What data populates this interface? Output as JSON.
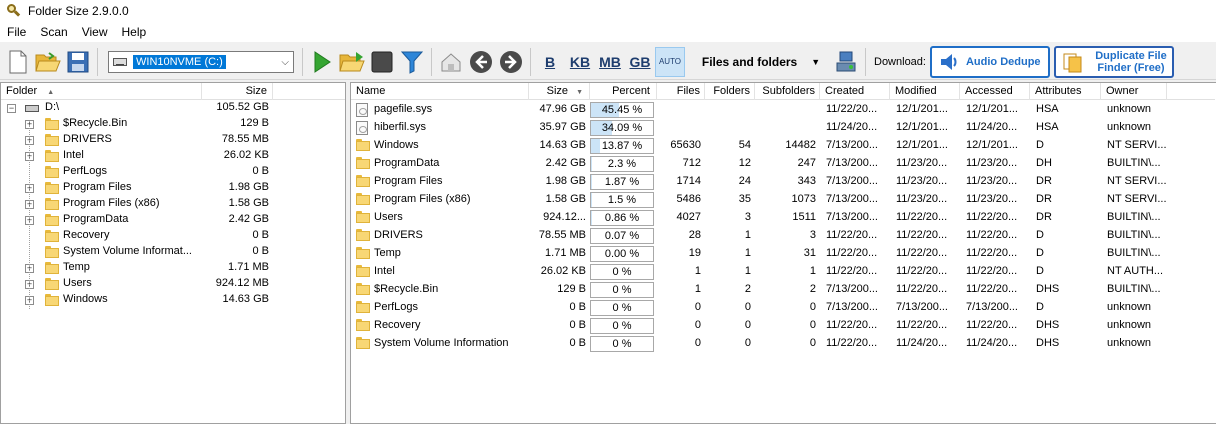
{
  "window": {
    "title": "Folder Size 2.9.0.0"
  },
  "menu": [
    "File",
    "Scan",
    "View",
    "Help"
  ],
  "toolbar": {
    "drive": "WIN10NVME (C:)",
    "units": [
      "B",
      "KB",
      "MB",
      "GB"
    ],
    "auto_label": "AUTO",
    "view_mode": "Files and folders",
    "download_label": "Download:",
    "audio_dedupe": "Audio Dedupe",
    "dup_finder_line1": "Duplicate File",
    "dup_finder_line2": "Finder (Free)"
  },
  "tree": {
    "headers": {
      "folder": "Folder",
      "size": "Size"
    },
    "root": {
      "name": "D:\\",
      "size": "105.52 GB"
    },
    "items": [
      {
        "name": "$Recycle.Bin",
        "size": "129 B",
        "expandable": true
      },
      {
        "name": "DRIVERS",
        "size": "78.55 MB",
        "expandable": true
      },
      {
        "name": "Intel",
        "size": "26.02 KB",
        "expandable": true
      },
      {
        "name": "PerfLogs",
        "size": "0 B",
        "expandable": false
      },
      {
        "name": "Program Files",
        "size": "1.98 GB",
        "expandable": true
      },
      {
        "name": "Program Files (x86)",
        "size": "1.58 GB",
        "expandable": true
      },
      {
        "name": "ProgramData",
        "size": "2.42 GB",
        "expandable": true
      },
      {
        "name": "Recovery",
        "size": "0 B",
        "expandable": false
      },
      {
        "name": "System Volume Informat...",
        "size": "0 B",
        "expandable": false
      },
      {
        "name": "Temp",
        "size": "1.71 MB",
        "expandable": true
      },
      {
        "name": "Users",
        "size": "924.12 MB",
        "expandable": true
      },
      {
        "name": "Windows",
        "size": "14.63 GB",
        "expandable": true
      }
    ]
  },
  "list": {
    "headers": {
      "name": "Name",
      "size": "Size",
      "percent": "Percent",
      "files": "Files",
      "folders": "Folders",
      "subfolders": "Subfolders",
      "created": "Created",
      "modified": "Modified",
      "accessed": "Accessed",
      "attributes": "Attributes",
      "owner": "Owner"
    },
    "rows": [
      {
        "type": "file",
        "name": "pagefile.sys",
        "size": "47.96 GB",
        "percent": "45.45 %",
        "pct": 45.45,
        "files": "",
        "folders": "",
        "subfolders": "",
        "created": "11/22/20...",
        "modified": "12/1/201...",
        "accessed": "12/1/201...",
        "attributes": "HSA",
        "owner": "unknown"
      },
      {
        "type": "file",
        "name": "hiberfil.sys",
        "size": "35.97 GB",
        "percent": "34.09 %",
        "pct": 34.09,
        "files": "",
        "folders": "",
        "subfolders": "",
        "created": "11/24/20...",
        "modified": "12/1/201...",
        "accessed": "11/24/20...",
        "attributes": "HSA",
        "owner": "unknown"
      },
      {
        "type": "folder",
        "name": "Windows",
        "size": "14.63 GB",
        "percent": "13.87 %",
        "pct": 13.87,
        "files": "65630",
        "folders": "54",
        "subfolders": "14482",
        "created": "7/13/200...",
        "modified": "12/1/201...",
        "accessed": "12/1/201...",
        "attributes": "D",
        "owner": "NT SERVI..."
      },
      {
        "type": "folder",
        "name": "ProgramData",
        "size": "2.42 GB",
        "percent": "2.3 %",
        "pct": 2.3,
        "files": "712",
        "folders": "12",
        "subfolders": "247",
        "created": "7/13/200...",
        "modified": "11/23/20...",
        "accessed": "11/23/20...",
        "attributes": "DH",
        "owner": "BUILTIN\\..."
      },
      {
        "type": "folder",
        "name": "Program Files",
        "size": "1.98 GB",
        "percent": "1.87 %",
        "pct": 1.87,
        "files": "1714",
        "folders": "24",
        "subfolders": "343",
        "created": "7/13/200...",
        "modified": "11/23/20...",
        "accessed": "11/23/20...",
        "attributes": "DR",
        "owner": "NT SERVI..."
      },
      {
        "type": "folder",
        "name": "Program Files (x86)",
        "size": "1.58 GB",
        "percent": "1.5 %",
        "pct": 1.5,
        "files": "5486",
        "folders": "35",
        "subfolders": "1073",
        "created": "7/13/200...",
        "modified": "11/23/20...",
        "accessed": "11/23/20...",
        "attributes": "DR",
        "owner": "NT SERVI..."
      },
      {
        "type": "folder",
        "name": "Users",
        "size": "924.12...",
        "percent": "0.86 %",
        "pct": 0.86,
        "files": "4027",
        "folders": "3",
        "subfolders": "1511",
        "created": "7/13/200...",
        "modified": "11/22/20...",
        "accessed": "11/22/20...",
        "attributes": "DR",
        "owner": "BUILTIN\\..."
      },
      {
        "type": "folder",
        "name": "DRIVERS",
        "size": "78.55 MB",
        "percent": "0.07 %",
        "pct": 0.07,
        "files": "28",
        "folders": "1",
        "subfolders": "3",
        "created": "11/22/20...",
        "modified": "11/22/20...",
        "accessed": "11/22/20...",
        "attributes": "D",
        "owner": "BUILTIN\\..."
      },
      {
        "type": "folder",
        "name": "Temp",
        "size": "1.71 MB",
        "percent": "0.00 %",
        "pct": 0,
        "files": "19",
        "folders": "1",
        "subfolders": "31",
        "created": "11/22/20...",
        "modified": "11/22/20...",
        "accessed": "11/22/20...",
        "attributes": "D",
        "owner": "BUILTIN\\..."
      },
      {
        "type": "folder",
        "name": "Intel",
        "size": "26.02 KB",
        "percent": "0 %",
        "pct": 0,
        "files": "1",
        "folders": "1",
        "subfolders": "1",
        "created": "11/22/20...",
        "modified": "11/22/20...",
        "accessed": "11/22/20...",
        "attributes": "D",
        "owner": "NT AUTH..."
      },
      {
        "type": "folder",
        "name": "$Recycle.Bin",
        "size": "129 B",
        "percent": "0 %",
        "pct": 0,
        "files": "1",
        "folders": "2",
        "subfolders": "2",
        "created": "7/13/200...",
        "modified": "11/22/20...",
        "accessed": "11/22/20...",
        "attributes": "DHS",
        "owner": "BUILTIN\\..."
      },
      {
        "type": "folder",
        "name": "PerfLogs",
        "size": "0 B",
        "percent": "0 %",
        "pct": 0,
        "files": "0",
        "folders": "0",
        "subfolders": "0",
        "created": "7/13/200...",
        "modified": "7/13/200...",
        "accessed": "7/13/200...",
        "attributes": "D",
        "owner": "unknown"
      },
      {
        "type": "folder",
        "name": "Recovery",
        "size": "0 B",
        "percent": "0 %",
        "pct": 0,
        "files": "0",
        "folders": "0",
        "subfolders": "0",
        "created": "11/22/20...",
        "modified": "11/22/20...",
        "accessed": "11/22/20...",
        "attributes": "DHS",
        "owner": "unknown"
      },
      {
        "type": "folder",
        "name": "System Volume Information",
        "size": "0 B",
        "percent": "0 %",
        "pct": 0,
        "files": "0",
        "folders": "0",
        "subfolders": "0",
        "created": "11/22/20...",
        "modified": "11/24/20...",
        "accessed": "11/24/20...",
        "attributes": "DHS",
        "owner": "unknown"
      }
    ]
  }
}
